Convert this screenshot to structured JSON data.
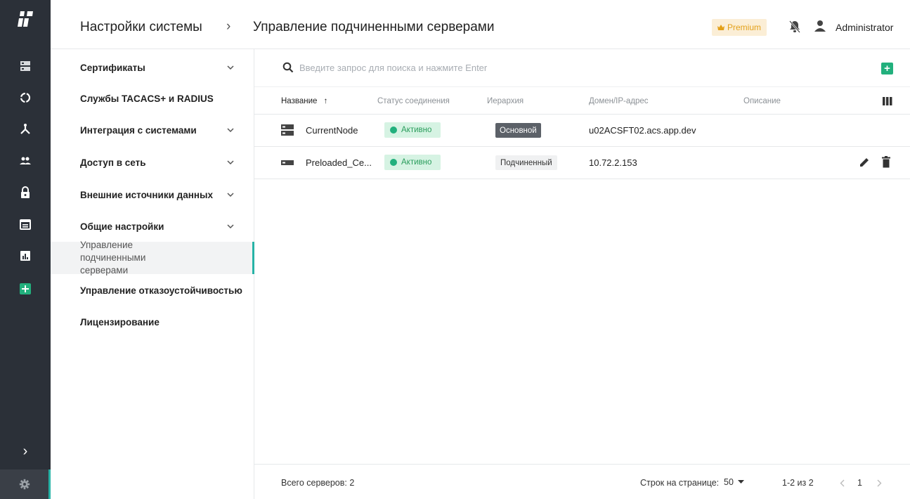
{
  "header": {
    "breadcrumb_root": "Настройки системы",
    "breadcrumb_separator": "›",
    "breadcrumb_current": "Управление подчиненными серверами",
    "premium_label": "Premium",
    "user_name": "Administrator"
  },
  "rail": {
    "items": [
      "servers-icon",
      "circle-refresh-icon",
      "network-icon",
      "users-icon",
      "lock-icon",
      "calendar-icon",
      "report-icon",
      "plus-icon"
    ],
    "expand_label": "›"
  },
  "subnav": {
    "items": [
      {
        "label": "Сертификаты",
        "expandable": true
      },
      {
        "label": "Службы TACACS+ и RADIUS",
        "expandable": false
      },
      {
        "label": "Интеграция с системами",
        "expandable": true
      },
      {
        "label": "Доступ в сеть",
        "expandable": true
      },
      {
        "label": "Внешние источники данных",
        "expandable": true
      },
      {
        "label": "Общие настройки",
        "expandable": true
      },
      {
        "label": "Управление подчиненными серверами",
        "expandable": false,
        "active": true
      },
      {
        "label": "Управление отказоустойчивостью",
        "expandable": false
      },
      {
        "label": "Лицензирование",
        "expandable": false
      }
    ]
  },
  "search": {
    "placeholder": "Введите запрос для поиска и нажмите Enter"
  },
  "table": {
    "columns": [
      "Название",
      "Статус соединения",
      "Иерархия",
      "Домен/IP-адрес",
      "Описание"
    ],
    "sort_indicator": "↑",
    "rows": [
      {
        "name": "CurrentNode",
        "status": "Активно",
        "hierarchy": "Основной",
        "address": "u02ACSFT02.acs.app.dev",
        "description": ""
      },
      {
        "name": "Preloaded_Ce...",
        "status": "Активно",
        "hierarchy": "Подчиненный",
        "address": "10.72.2.153",
        "description": ""
      }
    ]
  },
  "footer": {
    "total_label": "Всего серверов: 2",
    "rows_per_page_label": "Строк на странице:",
    "rows_per_page_value": "50",
    "range_label": "1-2 из 2",
    "current_page": "1"
  },
  "colors": {
    "rail_bg": "#2b3038",
    "accent": "#27b3a6",
    "success": "#22b07d",
    "premium": "#e3a11b"
  }
}
